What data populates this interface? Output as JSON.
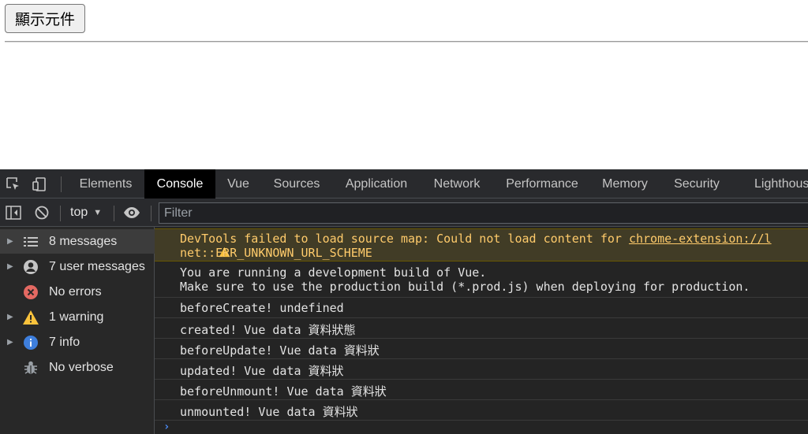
{
  "page": {
    "button_label": "顯示元件"
  },
  "devtools": {
    "tabs": [
      "Elements",
      "Console",
      "Vue",
      "Sources",
      "Application",
      "Network",
      "Performance",
      "Memory",
      "Security",
      "Lighthouse"
    ],
    "active_tab": "Console",
    "toolbar": {
      "context": "top",
      "filter_placeholder": "Filter"
    },
    "sidebar": [
      {
        "label": "8 messages",
        "icon": "list-icon",
        "expandable": true,
        "selected": true
      },
      {
        "label": "7 user messages",
        "icon": "user-icon",
        "expandable": true,
        "selected": false
      },
      {
        "label": "No errors",
        "icon": "error-icon",
        "expandable": false,
        "selected": false
      },
      {
        "label": "1 warning",
        "icon": "warning-icon",
        "expandable": true,
        "selected": false
      },
      {
        "label": "7 info",
        "icon": "info-icon",
        "expandable": true,
        "selected": false
      },
      {
        "label": "No verbose",
        "icon": "bug-icon",
        "expandable": false,
        "selected": false
      }
    ],
    "console": {
      "warning": {
        "line1_text": "DevTools failed to load source map: Could not load content for ",
        "line1_link": "chrome-extension://l",
        "line2": "net::ERR_UNKNOWN_URL_SCHEME"
      },
      "vue_msg": {
        "line1": "You are running a development build of Vue.",
        "line2": "Make sure to use the production build (*.prod.js) when deploying for production."
      },
      "logs": [
        "beforeCreate! undefined",
        "created! Vue data 資料狀態",
        "beforeUpdate! Vue data 資料狀",
        "updated! Vue data 資料狀",
        "beforeUnmount! Vue data 資料狀",
        "unmounted! Vue data 資料狀"
      ],
      "prompt": "›"
    }
  },
  "colors": {
    "devtools_bg": "#242424",
    "warning_bg": "#413c26",
    "warning_text": "#ffcb6b",
    "error_red": "#e46962",
    "warning_yellow": "#f9c23c",
    "info_blue": "#3e7fdd"
  }
}
